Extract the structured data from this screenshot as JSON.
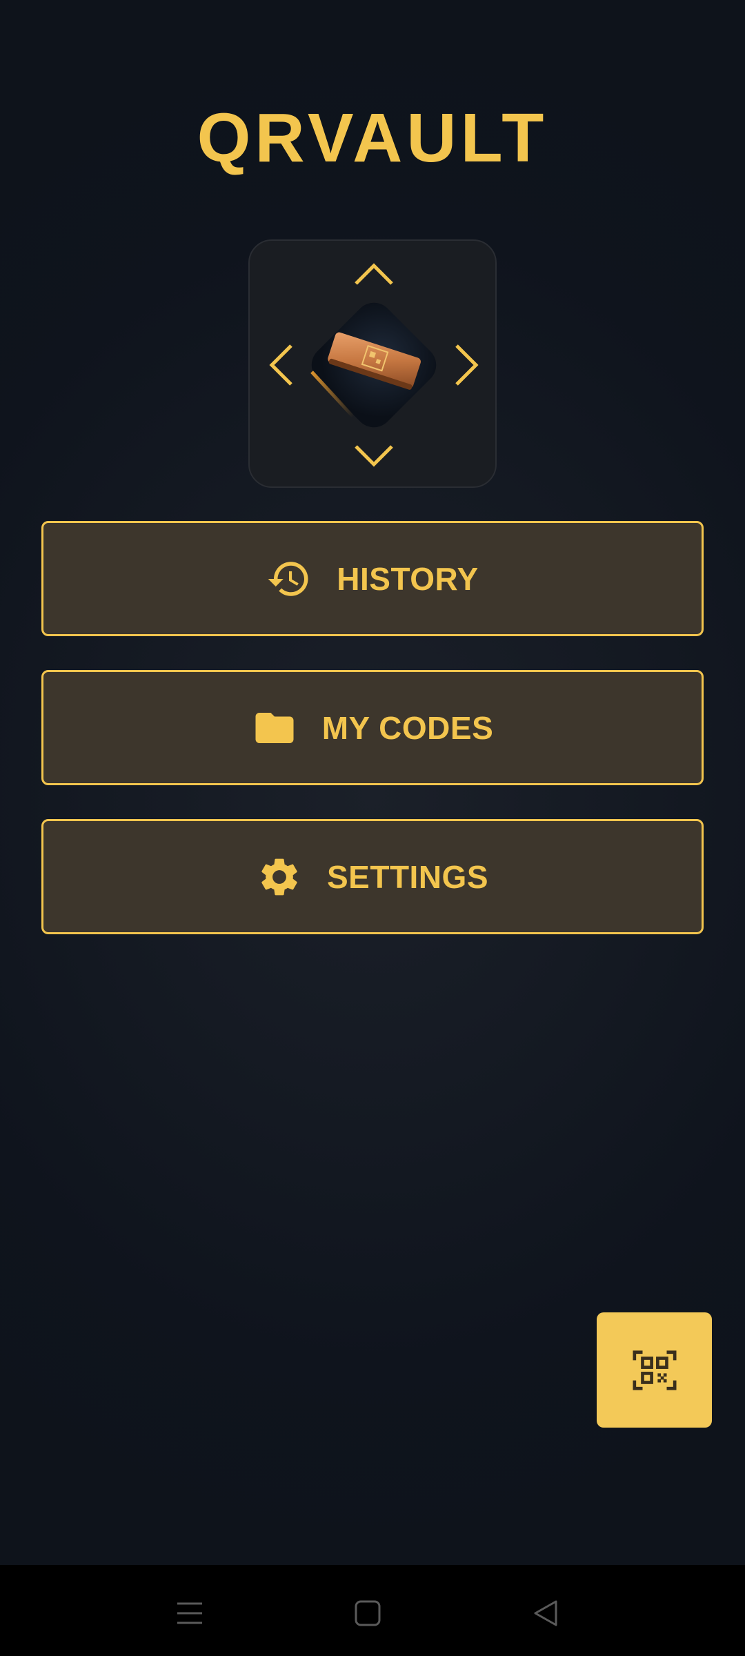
{
  "app": {
    "title": "QRVAULT"
  },
  "menu": {
    "history_label": "HISTORY",
    "codes_label": "MY CODES",
    "settings_label": "SETTINGS"
  },
  "icons": {
    "history": "history-icon",
    "codes": "folder-icon",
    "settings": "gear-icon",
    "scan": "qr-scan-icon",
    "nav_menu": "menu-icon",
    "nav_home": "home-icon",
    "nav_back": "back-icon"
  },
  "colors": {
    "accent": "#f3c54e",
    "button_bg": "#3d362c",
    "background": "#0f141d",
    "fab": "#f3c958"
  }
}
